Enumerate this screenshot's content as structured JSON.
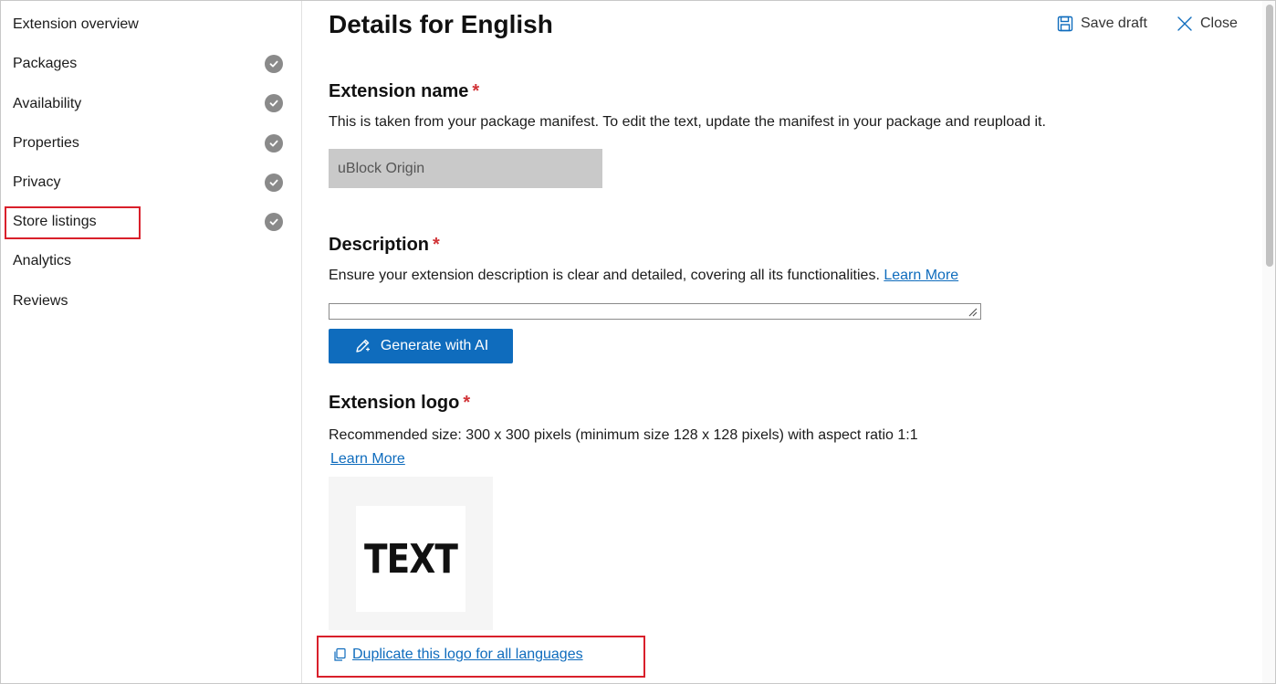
{
  "sidebar": {
    "items": [
      {
        "label": "Extension overview",
        "completed": false
      },
      {
        "label": "Packages",
        "completed": true
      },
      {
        "label": "Availability",
        "completed": true
      },
      {
        "label": "Properties",
        "completed": true
      },
      {
        "label": "Privacy",
        "completed": true
      },
      {
        "label": "Store listings",
        "completed": true,
        "highlighted": true
      },
      {
        "label": "Analytics",
        "completed": false
      },
      {
        "label": "Reviews",
        "completed": false
      }
    ]
  },
  "header": {
    "title": "Details for English",
    "save_label": "Save draft",
    "close_label": "Close"
  },
  "extension_name": {
    "title": "Extension name",
    "required_mark": "*",
    "help": "This is taken from your package manifest. To edit the text, update the manifest in your package and reupload it.",
    "value": "uBlock Origin"
  },
  "description": {
    "title": "Description",
    "required_mark": "*",
    "help": "Ensure your extension description is clear and detailed, covering all its functionalities.",
    "learn_more": "Learn More",
    "value": "",
    "generate_label": "Generate with AI"
  },
  "logo": {
    "title": "Extension logo",
    "required_mark": "*",
    "help": "Recommended size: 300 x 300 pixels (minimum size 128 x 128 pixels) with aspect ratio 1:1",
    "learn_more": "Learn More",
    "preview_text": "TEXT",
    "duplicate_label": "Duplicate this logo for all languages"
  },
  "colors": {
    "accent": "#0f6cbd",
    "required": "#d13438",
    "highlight": "#d9202b",
    "check": "#8a8a8a"
  },
  "icons": {
    "save": "save-icon",
    "close": "close-icon",
    "check": "check-circle-icon",
    "ai": "pencil-sparkle-icon",
    "copy": "copy-icon"
  }
}
